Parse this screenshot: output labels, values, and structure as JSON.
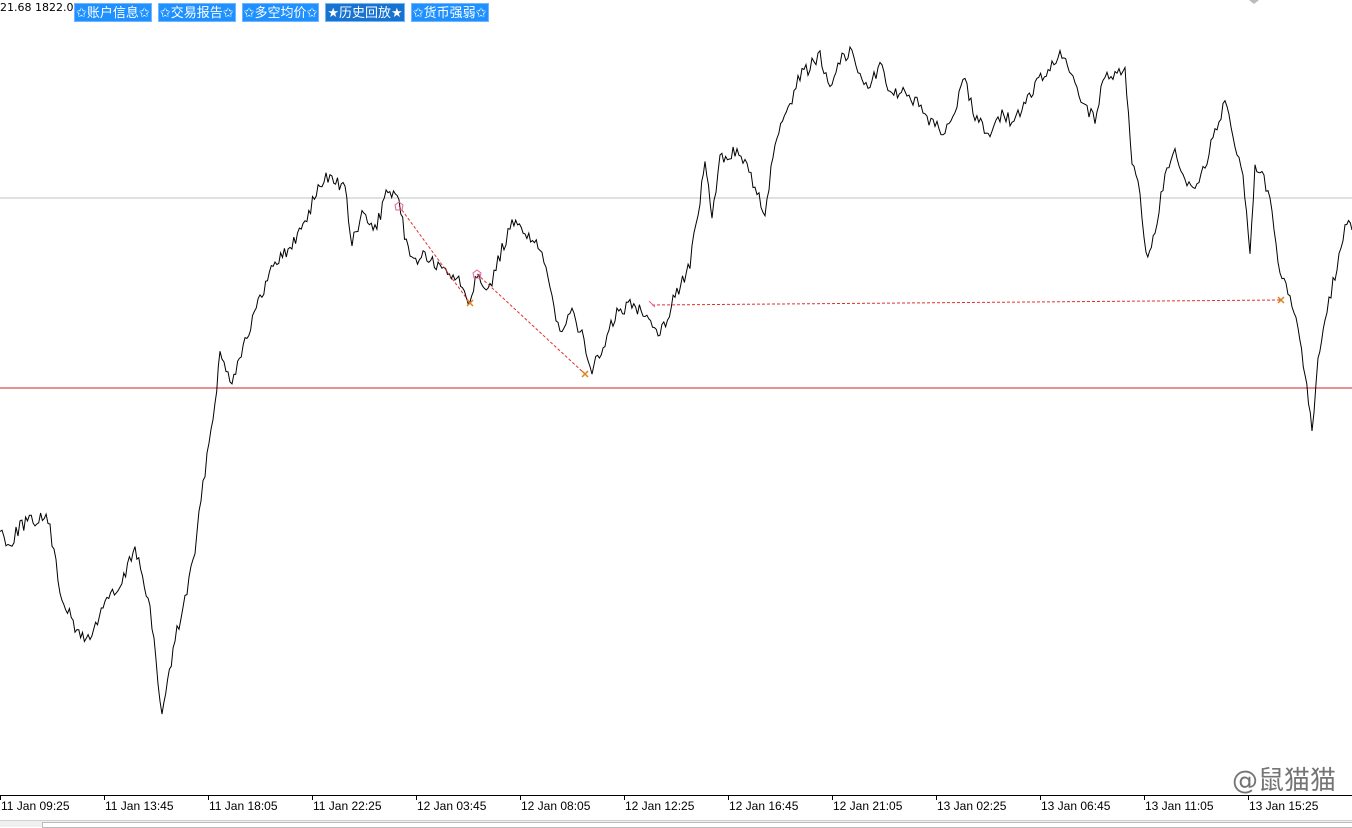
{
  "ticker": "21.68 1822.0",
  "toolbar": [
    {
      "label": "✩账户信息✩",
      "active": false
    },
    {
      "label": "✩交易报告✩",
      "active": false
    },
    {
      "label": "✩多空均价✩",
      "active": false
    },
    {
      "label": "★历史回放★",
      "active": true
    },
    {
      "label": "✩货币强弱✩",
      "active": false
    }
  ],
  "xaxis": [
    "11 Jan 09:25",
    "11 Jan 13:45",
    "11 Jan 18:05",
    "11 Jan 22:25",
    "12 Jan 03:45",
    "12 Jan 08:05",
    "12 Jan 12:25",
    "12 Jan 16:45",
    "12 Jan 21:05",
    "13 Jan 02:25",
    "13 Jan 06:45",
    "13 Jan 11:05",
    "13 Jan 15:25"
  ],
  "watermark": "@鼠猫猫",
  "colors": {
    "price_line": "#000000",
    "level_gray": "#c0c0c0",
    "level_red": "#cc2222",
    "trade_line": "#e03030",
    "marker_orange": "#e08020",
    "marker_pink": "#e060a0"
  }
}
